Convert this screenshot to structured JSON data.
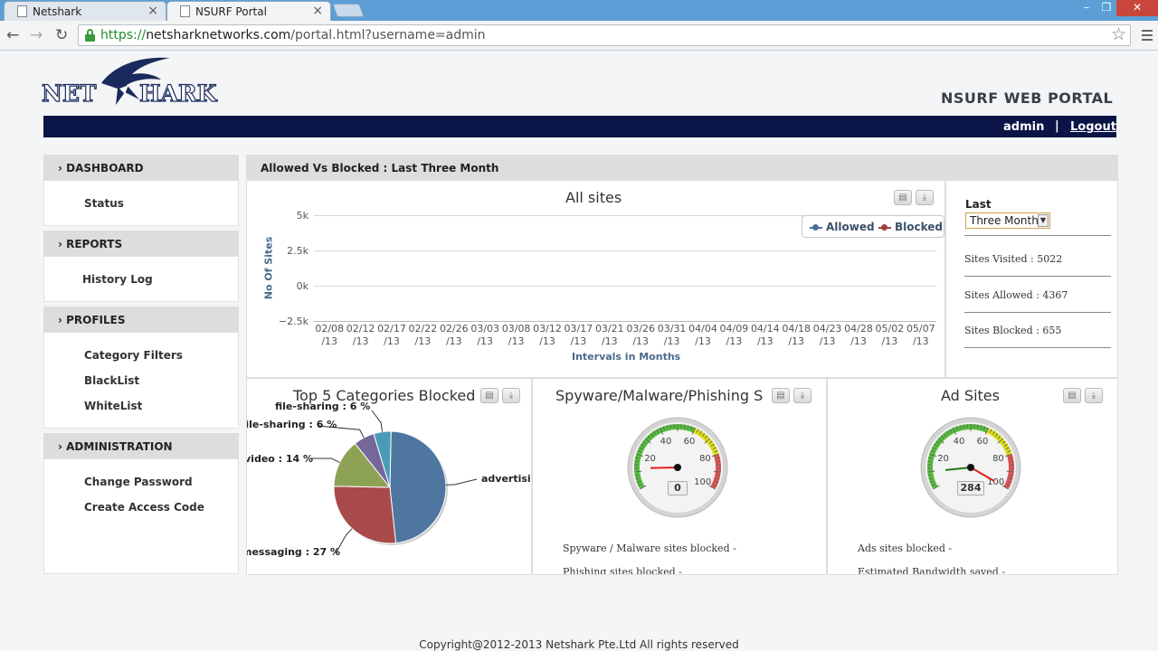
{
  "browser": {
    "tabs": [
      {
        "label": "Netshark",
        "close": "×"
      },
      {
        "label": "NSURF Portal",
        "close": "×"
      }
    ],
    "url": {
      "scheme": "https://",
      "host": "netsharknetworks.com",
      "path": "/portal.html?username=admin"
    },
    "controls": {
      "back": "←",
      "forward": "→",
      "reload": "↻",
      "star": "☆",
      "minimize": "–",
      "maximize": "❐",
      "close": "✕"
    }
  },
  "header": {
    "logo_text": "NET SHARK",
    "portal_title": "NSURF WEB PORTAL",
    "user": "admin",
    "separator": "|",
    "logout": "Logout"
  },
  "sidebar": {
    "sections": [
      {
        "title": "› DASHBOARD",
        "items": [
          "Status"
        ]
      },
      {
        "title": "› REPORTS",
        "items": [
          "History Log"
        ]
      },
      {
        "title": "› PROFILES",
        "items": [
          "Category Filters",
          "BlackList",
          "WhiteList"
        ]
      },
      {
        "title": "› ADMINISTRATION",
        "items": [
          "Change Password",
          "Create Access Code"
        ]
      }
    ]
  },
  "main": {
    "heading": "Allowed Vs Blocked : Last Three Month",
    "filter": {
      "label": "Last",
      "selected": "Three Month"
    },
    "stats": {
      "visited": "Sites Visited   :  5022",
      "allowed": "Sites Allowed  :  4367",
      "blocked": "Sites Blocked  :  655"
    },
    "spyware_panel": {
      "title": "Spyware/Malware/Phishing S",
      "line1": "Spyware / Malware sites blocked -",
      "line2": "Phishing sites blocked                -",
      "gauge_value": "0"
    },
    "ads_panel": {
      "title": "Ad Sites",
      "line1": "Ads sites blocked              -",
      "line2": "Estimated Bandwidth saved -",
      "gauge_value": "284"
    }
  },
  "chart_data": [
    {
      "type": "line",
      "title": "All sites",
      "xlabel": "Intervals in Months",
      "ylabel": "No Of Sites",
      "yticks": [
        "5k",
        "2.5k",
        "0k",
        "−2.5k"
      ],
      "ylim": [
        -2500,
        5000
      ],
      "x": [
        "02/08 /13",
        "02/12 /13",
        "02/17 /13",
        "02/22 /13",
        "02/26 /13",
        "03/03 /13",
        "03/08 /13",
        "03/12 /13",
        "03/17 /13",
        "03/21 /13",
        "03/26 /13",
        "03/31 /13",
        "04/04 /13",
        "04/09 /13",
        "04/14 /13",
        "04/18 /13",
        "04/23 /13",
        "04/28 /13",
        "05/02 /13",
        "05/07 /13"
      ],
      "series": [
        {
          "name": "Allowed",
          "color": "#4d7096",
          "values": []
        },
        {
          "name": "Blocked",
          "color": "#a0403e",
          "values": []
        }
      ],
      "legend": "top-right",
      "grid": true
    },
    {
      "type": "pie",
      "title": "Top 5 Categories Blocked",
      "slices": [
        {
          "label": "advertisi",
          "value": 48,
          "color": "#4e76a0"
        },
        {
          "label": "messaging : 27 %",
          "value": 27,
          "color": "#a84a4a"
        },
        {
          "label": "video : 14 %",
          "value": 14,
          "color": "#8ea255"
        },
        {
          "label": "file-sharing : 6 %",
          "value": 6,
          "color": "#75679a"
        },
        {
          "label": "file-sharing : 6 %",
          "value": 5,
          "color": "#4b9bb7"
        }
      ]
    }
  ],
  "footer": "Copyright@2012-2013 Netshark Pte.Ltd All rights reserved"
}
